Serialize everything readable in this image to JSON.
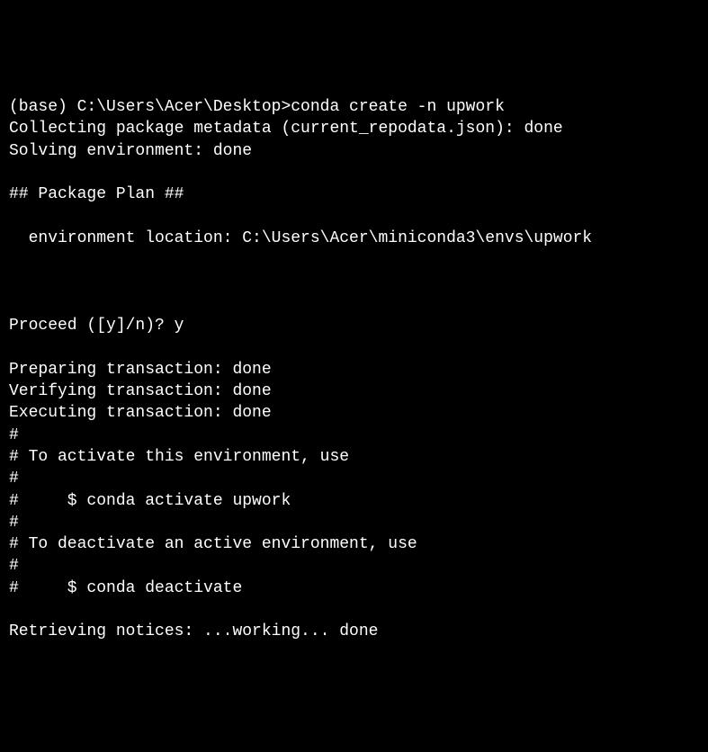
{
  "terminal": {
    "lines": [
      "(base) C:\\Users\\Acer\\Desktop>conda create -n upwork",
      "Collecting package metadata (current_repodata.json): done",
      "Solving environment: done",
      "",
      "## Package Plan ##",
      "",
      "  environment location: C:\\Users\\Acer\\miniconda3\\envs\\upwork",
      "",
      "",
      "",
      "Proceed ([y]/n)? y",
      "",
      "Preparing transaction: done",
      "Verifying transaction: done",
      "Executing transaction: done",
      "#",
      "# To activate this environment, use",
      "#",
      "#     $ conda activate upwork",
      "#",
      "# To deactivate an active environment, use",
      "#",
      "#     $ conda deactivate",
      "",
      "Retrieving notices: ...working... done"
    ]
  }
}
